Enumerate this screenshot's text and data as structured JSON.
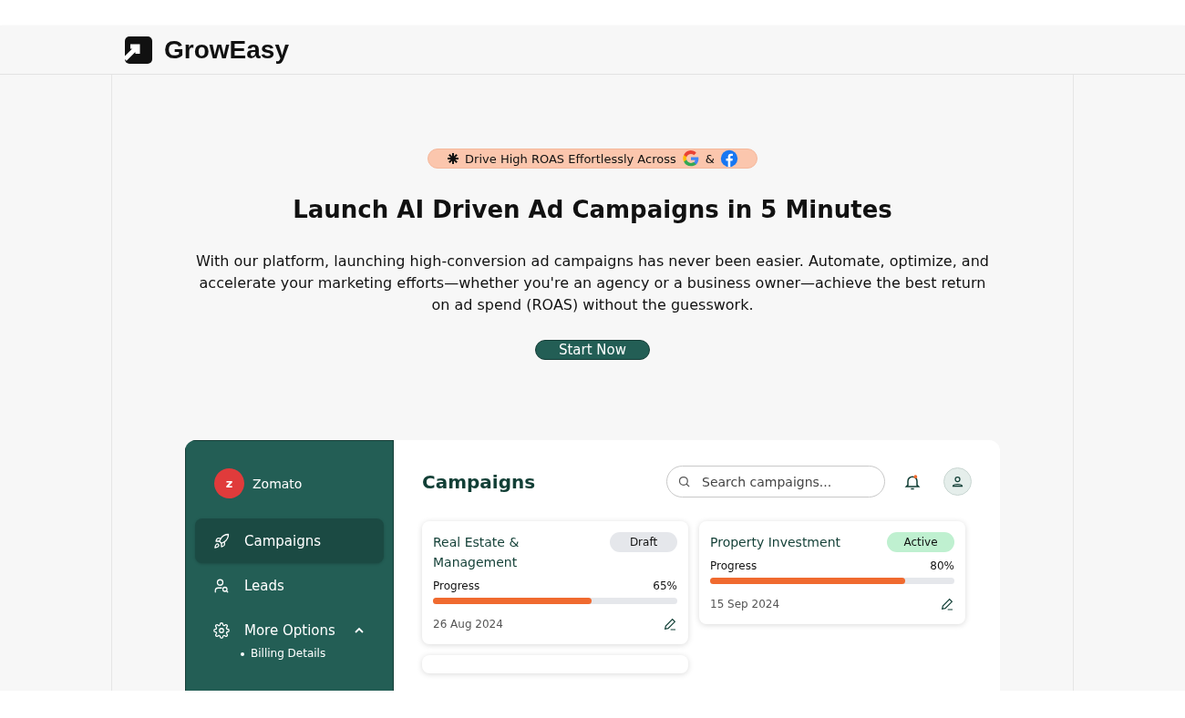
{
  "brand": {
    "name": "GrowEasy"
  },
  "hero": {
    "badge": {
      "text": "Drive High ROAS Effortlessly Across",
      "separator": "&"
    },
    "title": "Launch AI Driven Ad Campaigns in 5 Minutes",
    "description": "With our platform, launching high-conversion ad campaigns has never been easier. Automate, optimize, and accelerate your marketing efforts—whether you're an agency or a business owner—achieve the best return on ad spend (ROAS) without the guesswork.",
    "cta": "Start Now"
  },
  "dashboard": {
    "sidebar": {
      "account": {
        "initial": "z",
        "name": "Zomato"
      },
      "items": [
        {
          "kind": "rocket",
          "label": "Campaigns",
          "selected": true
        },
        {
          "kind": "user",
          "label": "Leads",
          "selected": false
        },
        {
          "kind": "gear",
          "label": "More Options",
          "selected": false,
          "expanded": true,
          "children": [
            {
              "label": "Billing Details"
            }
          ]
        }
      ]
    },
    "title": "Campaigns",
    "search": {
      "placeholder": "Search campaigns..."
    },
    "campaigns": [
      {
        "name": "Real Estate & Management",
        "status": "Draft",
        "kind": "draft",
        "progress_label": "Progress",
        "progress_value": "65%",
        "level": 0.65,
        "date": "26 Aug 2024"
      },
      {
        "name": "Property Investment",
        "status": "Active",
        "kind": "active",
        "progress_label": "Progress",
        "progress_value": "80%",
        "level": 0.8,
        "date": "15 Sep 2024"
      }
    ]
  }
}
